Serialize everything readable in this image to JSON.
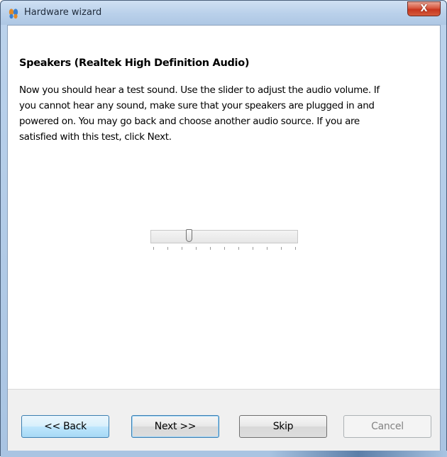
{
  "window": {
    "title": "Hardware wizard",
    "close_label": "X"
  },
  "content": {
    "heading": "Speakers (Realtek High Definition Audio)",
    "body_lines": [
      "Now you should hear a test sound.  Use the slider to adjust the audio volume.  If",
      "you cannot hear any sound, make sure that your speakers are plugged in and",
      "powered on.  You may go back and choose another audio source.  If you are",
      "satisfied with this test, click Next."
    ]
  },
  "volume_slider": {
    "value_fraction": 0.25,
    "tick_count": 11
  },
  "buttons": {
    "back": "<< Back",
    "next": "Next >>",
    "skip": "Skip",
    "cancel": "Cancel"
  },
  "colors": {
    "focus_border": "#3c7fb1",
    "disabled_text": "#838383"
  }
}
